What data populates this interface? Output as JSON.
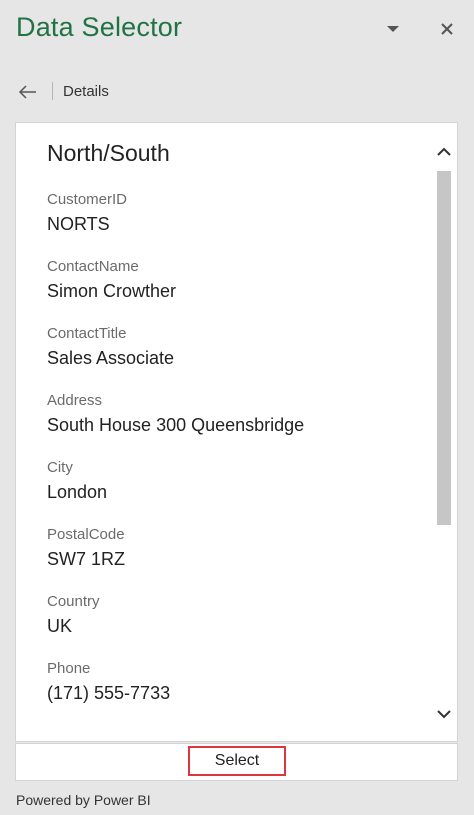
{
  "pane": {
    "title": "Data Selector",
    "dropdown_icon": "caret-down-icon",
    "close_icon": "close-icon"
  },
  "nav": {
    "back_icon": "arrow-left-icon",
    "breadcrumb": "Details"
  },
  "record": {
    "title": "North/South",
    "fields": [
      {
        "label": "CustomerID",
        "value": "NORTS"
      },
      {
        "label": "ContactName",
        "value": "Simon Crowther"
      },
      {
        "label": "ContactTitle",
        "value": "Sales Associate"
      },
      {
        "label": "Address",
        "value": "South House 300 Queensbridge"
      },
      {
        "label": "City",
        "value": "London"
      },
      {
        "label": "PostalCode",
        "value": "SW7 1RZ"
      },
      {
        "label": "Country",
        "value": "UK"
      },
      {
        "label": "Phone",
        "value": "(171) 555-7733"
      }
    ]
  },
  "footer": {
    "select_label": "Select",
    "powered_by": "Powered by Power BI"
  },
  "colors": {
    "title_green": "#217346",
    "select_border": "#e0353b",
    "pane_background": "#e6e6e6"
  }
}
